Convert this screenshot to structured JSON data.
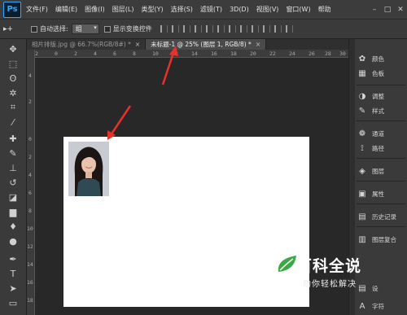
{
  "app": {
    "logo": "Ps"
  },
  "menu": [
    "文件(F)",
    "编辑(E)",
    "图像(I)",
    "图层(L)",
    "类型(Y)",
    "选择(S)",
    "滤镜(T)",
    "3D(D)",
    "视图(V)",
    "窗口(W)",
    "帮助"
  ],
  "window_controls": {
    "minimize": "–",
    "restore": "□",
    "close": "✕"
  },
  "options": {
    "tool_symbol": "▸+",
    "auto_select_label": "自动选择:",
    "auto_select_value": "组",
    "show_transform_label": "显示变换控件"
  },
  "tabs": [
    {
      "label": "相片排版.jpg @ 66.7%(RGB/8#) *",
      "close": "×"
    },
    {
      "label": "未标题-1 @ 25% (图层 1, RGB/8) *",
      "close": "×"
    }
  ],
  "ruler": {
    "top": [
      "2",
      "0",
      "2",
      "4",
      "6",
      "8",
      "10",
      "12",
      "14",
      "16",
      "18",
      "20",
      "22",
      "24",
      "26",
      "28",
      "30"
    ],
    "left": [
      "4",
      "2",
      "0",
      "2",
      "4",
      "6",
      "8",
      "10",
      "12",
      "14",
      "16",
      "18",
      "20"
    ]
  },
  "tools": [
    {
      "icon": "move-icon",
      "glyph": "✥"
    },
    {
      "icon": "marquee-icon",
      "glyph": "⬚"
    },
    {
      "icon": "lasso-icon",
      "glyph": "ʘ"
    },
    {
      "icon": "magic-wand-icon",
      "glyph": "✲"
    },
    {
      "icon": "crop-icon",
      "glyph": "⌗"
    },
    {
      "icon": "eyedropper-icon",
      "glyph": "⁄"
    },
    {
      "icon": "healing-brush-icon",
      "glyph": "✚"
    },
    {
      "icon": "brush-icon",
      "glyph": "✎"
    },
    {
      "icon": "clone-stamp-icon",
      "glyph": "⊥"
    },
    {
      "icon": "history-brush-icon",
      "glyph": "↺"
    },
    {
      "icon": "eraser-icon",
      "glyph": "◪"
    },
    {
      "icon": "gradient-icon",
      "glyph": "▆"
    },
    {
      "icon": "blur-icon",
      "glyph": "♦"
    },
    {
      "icon": "dodge-icon",
      "glyph": "●"
    },
    {
      "icon": "pen-icon",
      "glyph": "✒"
    },
    {
      "icon": "type-icon",
      "glyph": "T"
    },
    {
      "icon": "path-select-icon",
      "glyph": "➤"
    },
    {
      "icon": "shape-icon",
      "glyph": "▭"
    }
  ],
  "panels": [
    {
      "label": "颜色",
      "icon": "color-icon",
      "glyph": "✿"
    },
    {
      "label": "色板",
      "icon": "swatches-icon",
      "glyph": "▦"
    },
    {
      "label": "调整",
      "icon": "adjustments-icon",
      "glyph": "◑"
    },
    {
      "label": "样式",
      "icon": "styles-icon",
      "glyph": "✎"
    },
    {
      "label": "通道",
      "icon": "channels-icon",
      "glyph": "❁"
    },
    {
      "label": "路径",
      "icon": "paths-icon",
      "glyph": "⟟"
    },
    {
      "label": "图层",
      "icon": "layers-icon",
      "glyph": "◈"
    },
    {
      "label": "属性",
      "icon": "properties-icon",
      "glyph": "▣"
    },
    {
      "label": "历史记录",
      "icon": "history-icon",
      "glyph": "▤"
    },
    {
      "label": "图层复合",
      "icon": "layer-comps-icon",
      "glyph": "▥"
    },
    {
      "label": "设",
      "icon": "settings-icon",
      "glyph": "▤"
    },
    {
      "label": "字符",
      "icon": "character-icon",
      "glyph": "A"
    }
  ],
  "watermark": {
    "title": "百科全说",
    "subtitle": "助你轻松解决"
  },
  "colors": {
    "accent_arrow": "#e8312b",
    "canvas": "#ffffff",
    "workspace": "#282828",
    "ui_panel": "#3a3a3a"
  }
}
